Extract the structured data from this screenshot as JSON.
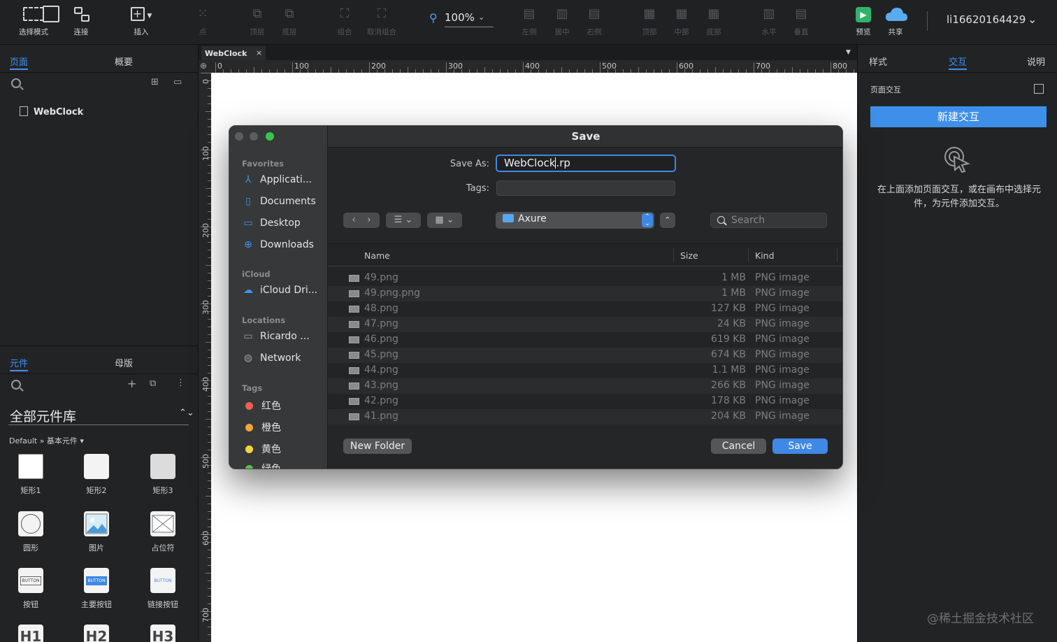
{
  "toolbar": {
    "items": [
      {
        "label": "选择模式",
        "icon": "select-mode-icon"
      },
      {
        "label": "连接",
        "icon": "connect-icon"
      },
      {
        "label": "插入",
        "icon": "insert-icon"
      },
      {
        "label": "点",
        "icon": "point-icon"
      },
      {
        "label": "顶层",
        "icon": "bring-front-icon"
      },
      {
        "label": "底层",
        "icon": "send-back-icon"
      },
      {
        "label": "组合",
        "icon": "group-icon"
      },
      {
        "label": "取消组合",
        "icon": "ungroup-icon"
      },
      {
        "label": "左侧",
        "icon": "align-left-icon"
      },
      {
        "label": "居中",
        "icon": "align-center-icon"
      },
      {
        "label": "右侧",
        "icon": "align-right-icon"
      },
      {
        "label": "顶部",
        "icon": "align-top-icon"
      },
      {
        "label": "中部",
        "icon": "align-middle-icon"
      },
      {
        "label": "底部",
        "icon": "align-bottom-icon"
      },
      {
        "label": "水平",
        "icon": "distribute-horizontal-icon"
      },
      {
        "label": "垂直",
        "icon": "distribute-vertical-icon"
      },
      {
        "label": "预览",
        "icon": "preview-icon"
      },
      {
        "label": "共享",
        "icon": "share-cloud-icon"
      }
    ],
    "zoom": "100%",
    "user": "li16620164429"
  },
  "pages_panel": {
    "tabs": [
      "页面",
      "概要"
    ],
    "pages": [
      "WebClock"
    ]
  },
  "library_panel": {
    "tabs": [
      "元件",
      "母版"
    ],
    "title": "全部元件库",
    "path": "Default » 基本元件",
    "widgets": [
      "矩形1",
      "矩形2",
      "矩形3",
      "圆形",
      "图片",
      "占位符",
      "按钮",
      "主要按钮",
      "链接按钮",
      "H1",
      "H2",
      "H3"
    ],
    "button_text": "BUTTON"
  },
  "canvas": {
    "tab": "WebClock",
    "close": "×",
    "ruler_h": [
      "0",
      "100",
      "200",
      "300",
      "400",
      "500",
      "600",
      "700",
      "800"
    ],
    "ruler_v": [
      "0",
      "100",
      "200",
      "300",
      "400",
      "500",
      "600",
      "700"
    ]
  },
  "right_panel": {
    "tabs": [
      "样式",
      "交互",
      "说明"
    ],
    "section": "页面交互",
    "new_button": "新建交互",
    "hint": "在上面添加页面交互，或在画布中选择元件，为元件添加交互。"
  },
  "watermark": "@稀土掘金技术社区",
  "dialog": {
    "title": "Save",
    "save_as_label": "Save As:",
    "save_as_value": "WebClock.rp",
    "tags_label": "Tags:",
    "location": "Axure",
    "search_placeholder": "Search",
    "sidebar": {
      "favorites_header": "Favorites",
      "favorites": [
        "Applicati...",
        "Documents",
        "Desktop",
        "Downloads"
      ],
      "icloud_header": "iCloud",
      "icloud": [
        "iCloud Dri..."
      ],
      "locations_header": "Locations",
      "locations": [
        "Ricardo ...",
        "Network"
      ],
      "tags_header": "Tags",
      "tags": [
        {
          "name": "红色",
          "color": "#ec5f59"
        },
        {
          "name": "橙色",
          "color": "#f3a535"
        },
        {
          "name": "黄色",
          "color": "#f5d73c"
        },
        {
          "name": "绿色",
          "color": "#58c150"
        }
      ]
    },
    "columns": [
      "Name",
      "Size",
      "Kind"
    ],
    "files": [
      {
        "name": "49.png",
        "size": "1 MB",
        "kind": "PNG image"
      },
      {
        "name": "49.png.png",
        "size": "1 MB",
        "kind": "PNG image"
      },
      {
        "name": "48.png",
        "size": "127 KB",
        "kind": "PNG image"
      },
      {
        "name": "47.png",
        "size": "24 KB",
        "kind": "PNG image"
      },
      {
        "name": "46.png",
        "size": "619 KB",
        "kind": "PNG image"
      },
      {
        "name": "45.png",
        "size": "674 KB",
        "kind": "PNG image"
      },
      {
        "name": "44.png",
        "size": "1.1 MB",
        "kind": "PNG image"
      },
      {
        "name": "43.png",
        "size": "266 KB",
        "kind": "PNG image"
      },
      {
        "name": "42.png",
        "size": "178 KB",
        "kind": "PNG image"
      },
      {
        "name": "41.png",
        "size": "204 KB",
        "kind": "PNG image"
      }
    ],
    "new_folder": "New Folder",
    "cancel": "Cancel",
    "save": "Save"
  }
}
